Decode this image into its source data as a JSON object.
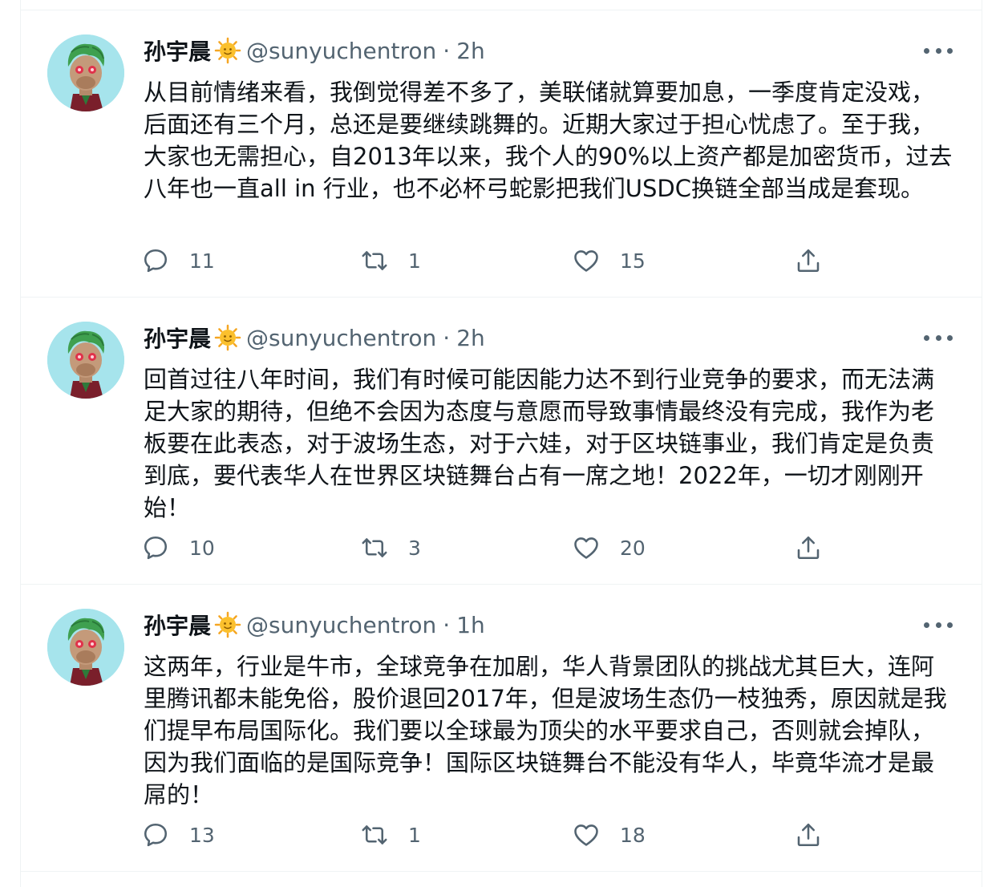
{
  "tweets": [
    {
      "name": "孙宇晨",
      "badge_icon": "sun-emoji",
      "handle": "@sunyuchentron",
      "separator": "·",
      "time": "2h",
      "text": "从目前情绪来看，我倒觉得差不多了，美联储就算要加息，一季度肯定没戏，后面还有三个月，总还是要继续跳舞的。近期大家过于担心忧虑了。至于我，大家也无需担心，自2013年以来，我个人的90%以上资产都是加密货币，过去八年也一直all in 行业，也不必杯弓蛇影把我们USDC换链全部当成是套现。",
      "replies": "11",
      "retweets": "1",
      "likes": "15"
    },
    {
      "name": "孙宇晨",
      "badge_icon": "sun-emoji",
      "handle": "@sunyuchentron",
      "separator": "·",
      "time": "2h",
      "text": "回首过往八年时间，我们有时候可能因能力达不到行业竞争的要求，而无法满足大家的期待，但绝不会因为态度与意愿而导致事情最终没有完成，我作为老板要在此表态，对于波场生态，对于六娃，对于区块链事业，我们肯定是负责到底，要代表华人在世界区块链舞台占有一席之地！2022年，一切才刚刚开始！",
      "replies": "10",
      "retweets": "3",
      "likes": "20"
    },
    {
      "name": "孙宇晨",
      "badge_icon": "sun-emoji",
      "handle": "@sunyuchentron",
      "separator": "·",
      "time": "1h",
      "text": "这两年，行业是牛市，全球竞争在加剧，华人背景团队的挑战尤其巨大，连阿里腾讯都未能免俗，股价退回2017年，但是波场生态仍一枝独秀，原因就是我们提早布局国际化。我们要以全球最为顶尖的水平要求自己，否则就会掉队，因为我们面临的是国际竞争！国际区块链舞台不能没有华人，毕竟华流才是最屌的！",
      "replies": "13",
      "retweets": "1",
      "likes": "18"
    }
  ],
  "colors": {
    "text": "#0f1419",
    "secondary": "#536471",
    "border": "#eff3f4",
    "avatar_bg": "#a6e4ec"
  }
}
